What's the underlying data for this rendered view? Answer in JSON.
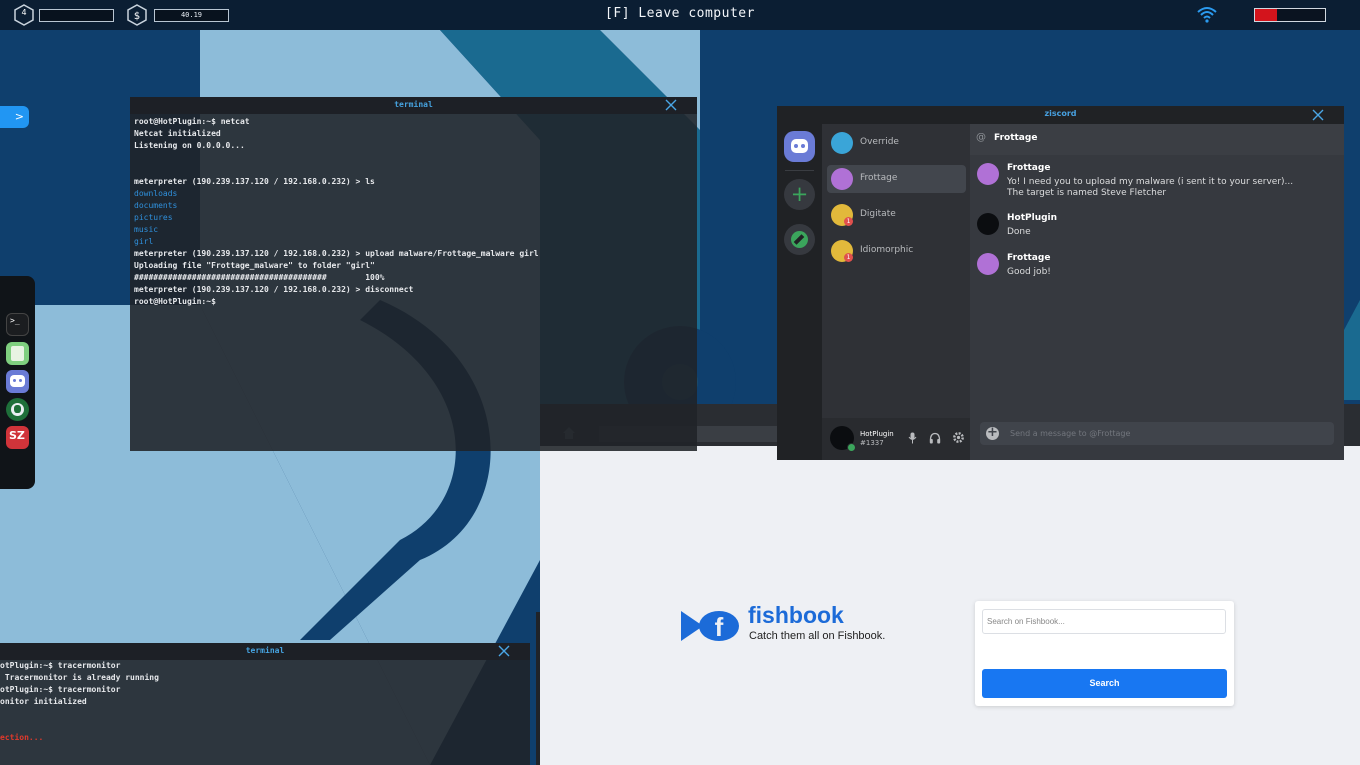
{
  "topbar": {
    "level": "4",
    "money": "40.19",
    "leave_label": "[F] Leave computer",
    "health_fraction": 0.32,
    "colors": {
      "health": "#d3141c"
    }
  },
  "side_tab": {
    "label": ">"
  },
  "dock": {
    "icons": [
      "terminal-icon",
      "notes-icon",
      "ziscord-icon",
      "browser-globe-icon",
      "sz-app-icon"
    ]
  },
  "terminal_main": {
    "title": "terminal",
    "lines": [
      {
        "text": "root@HotPlugin:~$ netcat",
        "style": "white"
      },
      {
        "text": "Netcat initialized",
        "style": "white"
      },
      {
        "text": "Listening on 0.0.0.0...",
        "style": "white"
      },
      {
        "text": "",
        "style": "white"
      },
      {
        "text": "",
        "style": "white"
      },
      {
        "text": "meterpreter (190.239.137.120 / 192.168.0.232) > ls",
        "style": "white"
      },
      {
        "text": "downloads",
        "style": "blue"
      },
      {
        "text": "documents",
        "style": "blue"
      },
      {
        "text": "pictures",
        "style": "blue"
      },
      {
        "text": "music",
        "style": "blue"
      },
      {
        "text": "girl",
        "style": "blue"
      },
      {
        "text": "meterpreter (190.239.137.120 / 192.168.0.232) > upload malware/Frottage_malware girl",
        "style": "white"
      },
      {
        "text": "Uploading file \"Frottage_malware\" to folder \"girl\"",
        "style": "white"
      },
      {
        "text": "########################################        100%",
        "style": "white"
      },
      {
        "text": "meterpreter (190.239.137.120 / 192.168.0.232) > disconnect",
        "style": "white"
      },
      {
        "text": "root@HotPlugin:~$",
        "style": "white"
      }
    ]
  },
  "terminal_bottom": {
    "title": "terminal",
    "lines": [
      {
        "text": "otPlugin:~$ tracermonitor",
        "style": "white"
      },
      {
        "text": " Tracermonitor is already running",
        "style": "white"
      },
      {
        "text": "otPlugin:~$ tracermonitor",
        "style": "white"
      },
      {
        "text": "onitor initialized",
        "style": "white"
      },
      {
        "text": "",
        "style": "white"
      },
      {
        "text": "",
        "style": "white"
      },
      {
        "text": "ection...",
        "style": "red"
      }
    ]
  },
  "ziscord": {
    "title": "ziscord",
    "dms": [
      {
        "name": "Override",
        "badge": ""
      },
      {
        "name": "Frottage",
        "badge": ""
      },
      {
        "name": "Digitate",
        "badge": "1"
      },
      {
        "name": "Idiomorphic",
        "badge": "1"
      }
    ],
    "chat_header": "Frottage",
    "messages": [
      {
        "author": "Frottage",
        "text": "Yo! I need you to upload my malware (i sent it to your server)... The target is named Steve Fletcher"
      },
      {
        "author": "HotPlugin",
        "text": "Done"
      },
      {
        "author": "Frottage",
        "text": "Good job!"
      }
    ],
    "user": {
      "name": "HotPlugin",
      "tag": "#1337"
    },
    "input_placeholder": "Send a message to @Frottage"
  },
  "fishbook": {
    "brand": "fishbook",
    "tagline": "Catch them all on Fishbook.",
    "search_placeholder": "Search on Fishbook...",
    "search_button": "Search"
  }
}
